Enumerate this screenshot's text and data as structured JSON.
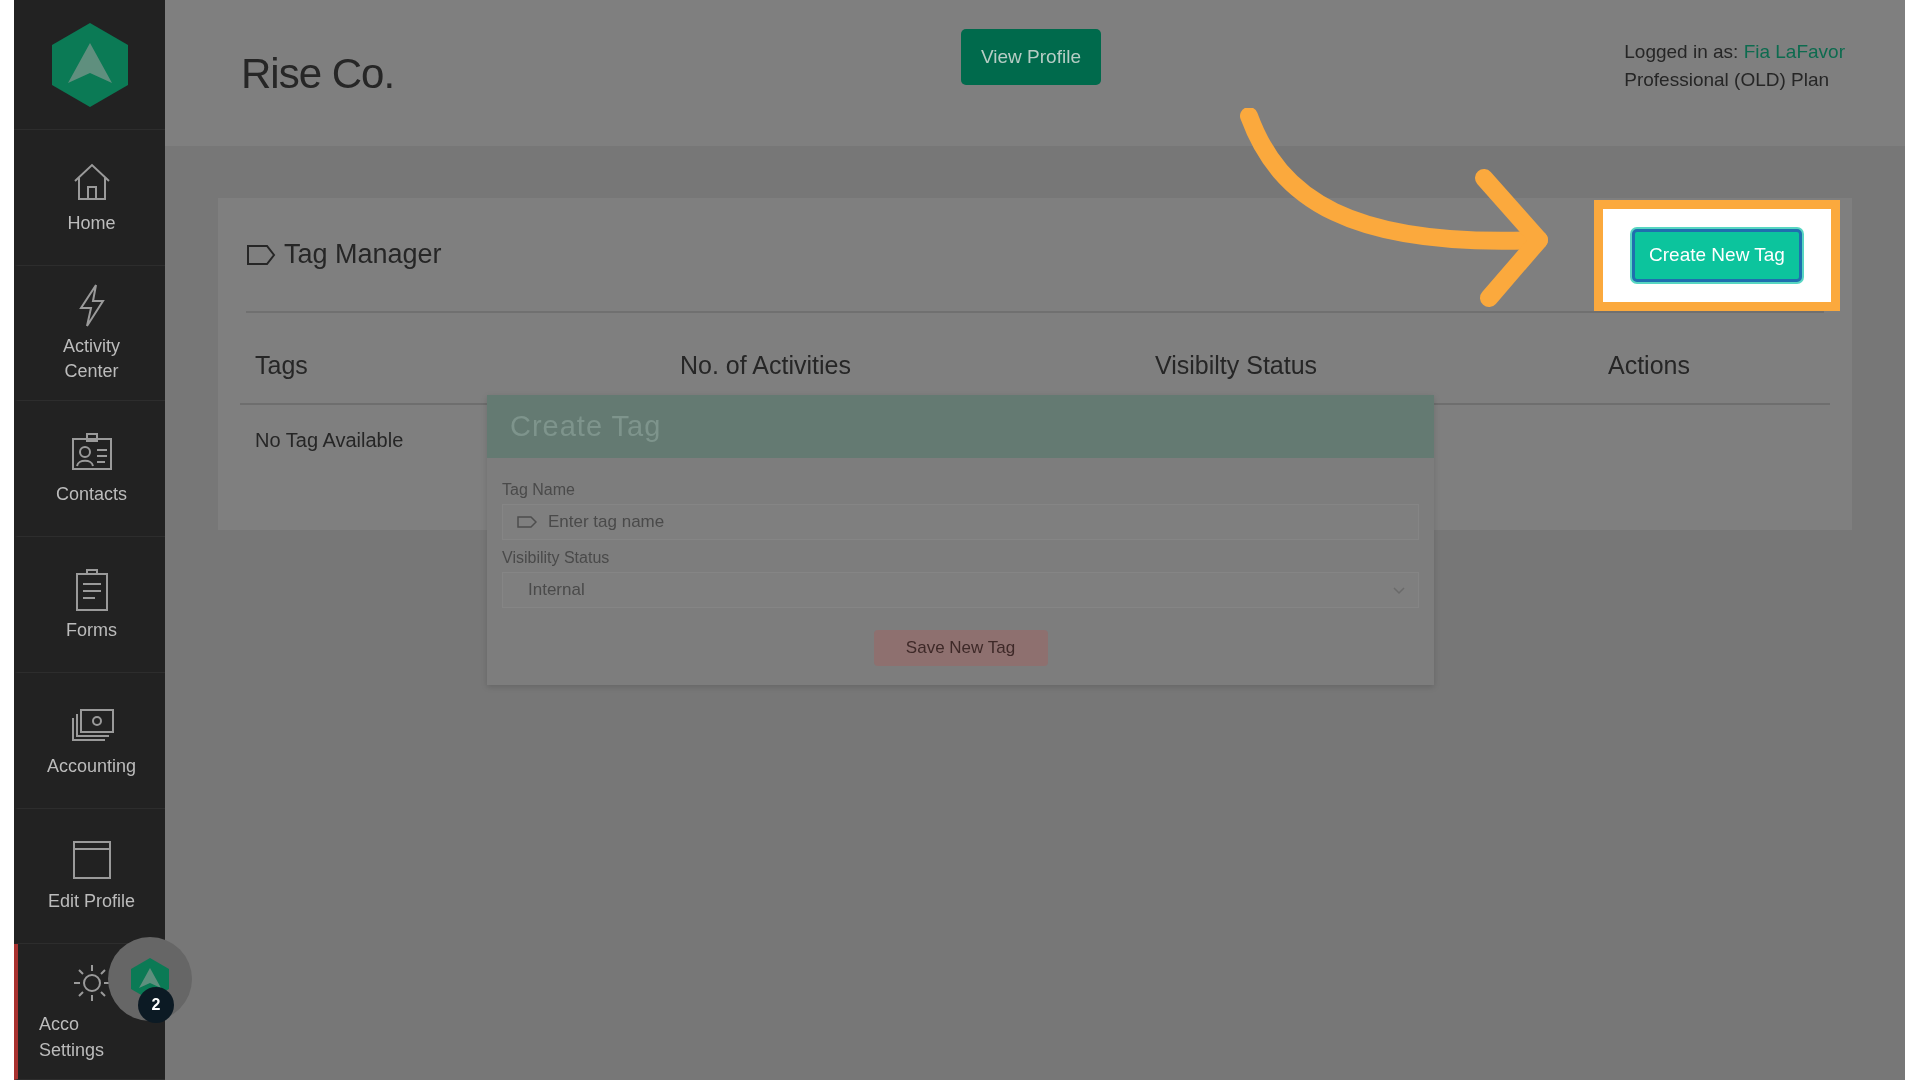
{
  "sidebar": {
    "items": [
      {
        "label": "Home",
        "selected": false
      },
      {
        "label": "Activity Center",
        "selected": false
      },
      {
        "label": "Contacts",
        "selected": false
      },
      {
        "label": "Forms",
        "selected": false
      },
      {
        "label": "Accounting",
        "selected": false
      },
      {
        "label": "Edit Profile",
        "selected": false
      },
      {
        "label": "Acco",
        "label_end": "Settings",
        "selected": true
      }
    ]
  },
  "header": {
    "company": "Rise Co.",
    "view_profile": "View Profile",
    "logged_in_label": "Logged in as:",
    "user": "Fia LaFavor",
    "plan": "Professional (OLD) Plan"
  },
  "tag_manager": {
    "title": "Tag Manager",
    "create_button": "Create New Tag",
    "columns": [
      "Tags",
      "No. of Activities",
      "Visibilty Status",
      "Actions"
    ],
    "empty": "No Tag Available"
  },
  "modal": {
    "title": "Create Tag",
    "fields": [
      {
        "kind": "text",
        "label": "Tag Name",
        "placeholder": "Enter tag name"
      },
      {
        "kind": "select",
        "label": "Visibility Status",
        "value": "Internal"
      }
    ],
    "save_button": "Save New Tag"
  },
  "help_widget": {
    "badge": "2"
  }
}
